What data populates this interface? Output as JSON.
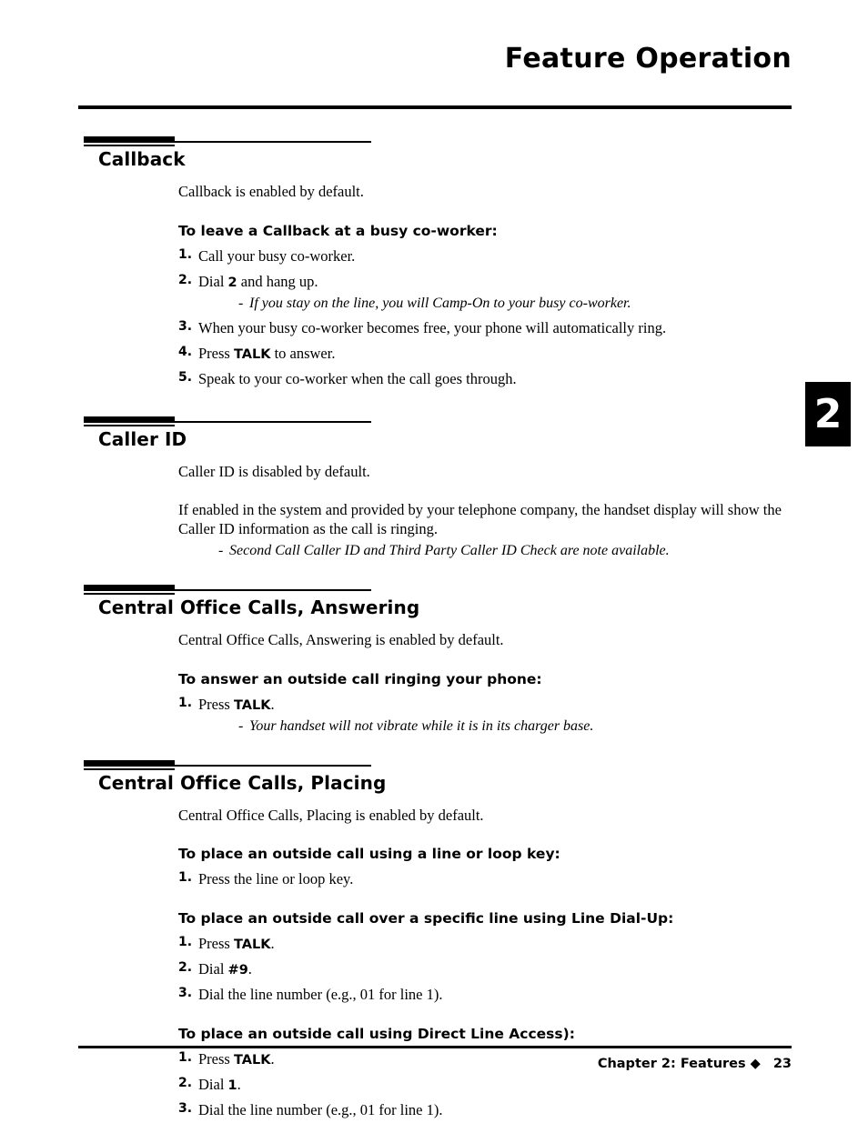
{
  "header": {
    "title": "Feature Operation"
  },
  "chapter_tab": {
    "number": "2"
  },
  "footer": {
    "chapter_label": "Chapter 2: Features",
    "separator": "◆",
    "page_number": "23"
  },
  "sections": [
    {
      "title": "Callback",
      "intro": "Callback is enabled by default.",
      "subhead": "To leave a Callback at a busy co-worker:",
      "steps": [
        {
          "num": "1.",
          "pre": "Call your busy co-worker.",
          "kbd": "",
          "post": ""
        },
        {
          "num": "2.",
          "pre": "Dial ",
          "kbd": "2",
          "post": " and hang up."
        },
        {
          "num": "3.",
          "pre": "When your busy co-worker becomes free, your phone will automatically ring.",
          "kbd": "",
          "post": ""
        },
        {
          "num": "4.",
          "pre": "Press ",
          "kbd": "TALK",
          "post": " to answer."
        },
        {
          "num": "5.",
          "pre": "Speak to your co-worker when the call goes through.",
          "kbd": "",
          "post": ""
        }
      ],
      "note_after_step": {
        "index": 1,
        "dash": "-",
        "text": "If you stay on the line, you will Camp-On to your busy co-worker."
      }
    },
    {
      "title": "Caller ID",
      "intro": "Caller ID is disabled by default.",
      "para2": "If enabled in the system and provided by your telephone company, the handset display will show the Caller ID information as the call is ringing.",
      "note": {
        "dash": "-",
        "text": "Second Call Caller ID and Third Party Caller ID Check are note available."
      }
    },
    {
      "title": "Central Office Calls, Answering",
      "intro": "Central Office Calls, Answering is enabled by default.",
      "subhead": "To answer an outside call ringing your phone:",
      "steps": [
        {
          "num": "1.",
          "pre": "Press ",
          "kbd": "TALK",
          "post": "."
        }
      ],
      "note_after_step": {
        "index": 0,
        "dash": "-",
        "text": "Your handset will not vibrate while it is in its charger base."
      }
    },
    {
      "title": "Central Office Calls, Placing",
      "intro": "Central Office Calls, Placing is enabled by default.",
      "groups": [
        {
          "subhead": "To place an outside call using a line or loop key:",
          "steps": [
            {
              "num": "1.",
              "pre": "Press the line or loop key.",
              "kbd": "",
              "post": ""
            }
          ]
        },
        {
          "subhead": "To place an outside call over a specific line using Line Dial-Up:",
          "steps": [
            {
              "num": "1.",
              "pre": "Press ",
              "kbd": "TALK",
              "post": "."
            },
            {
              "num": "2.",
              "pre": "Dial ",
              "kbd": "#9",
              "post": "."
            },
            {
              "num": "3.",
              "pre": "Dial the line number (e.g., 01 for line 1).",
              "kbd": "",
              "post": ""
            }
          ]
        },
        {
          "subhead": "To place an outside call using Direct Line Access):",
          "steps": [
            {
              "num": "1.",
              "pre": "Press ",
              "kbd": "TALK",
              "post": "."
            },
            {
              "num": "2.",
              "pre": "Dial ",
              "kbd": "1",
              "post": "."
            },
            {
              "num": "3.",
              "pre": "Dial the line number (e.g., 01 for line 1).",
              "kbd": "",
              "post": ""
            }
          ]
        }
      ]
    }
  ]
}
